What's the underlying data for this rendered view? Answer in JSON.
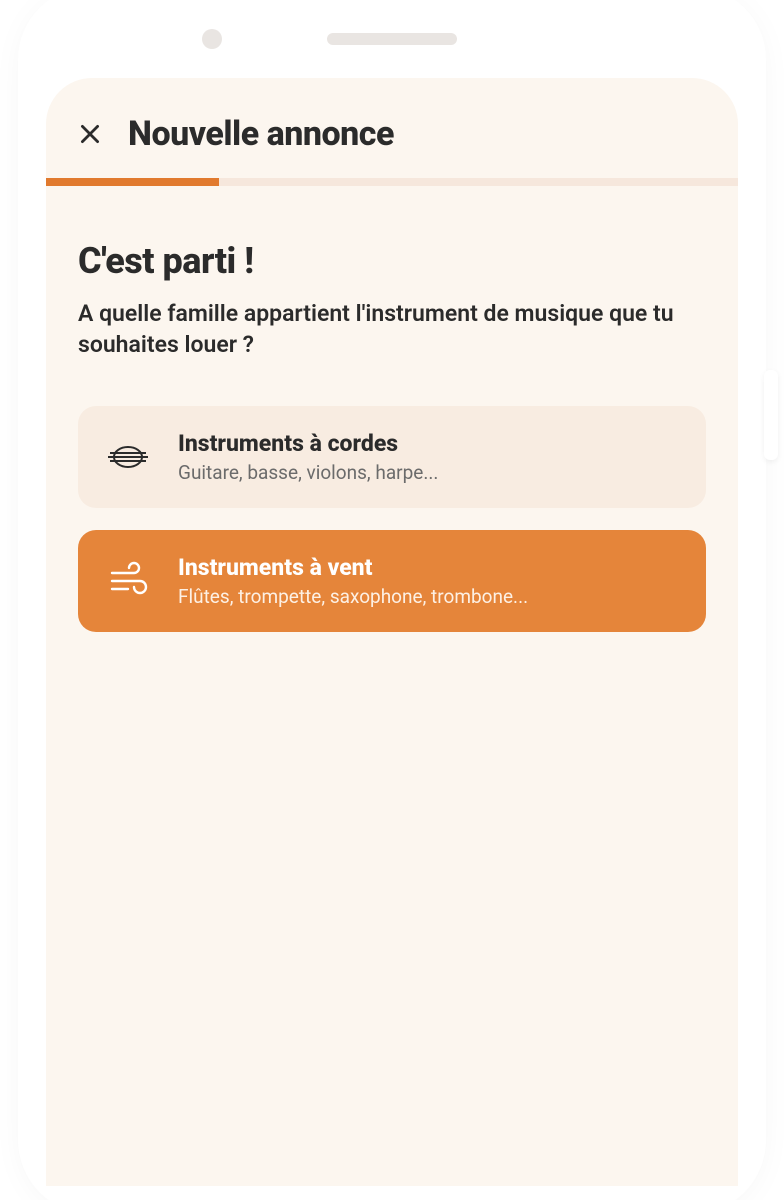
{
  "header": {
    "title": "Nouvelle annonce"
  },
  "progress": {
    "percent": 25
  },
  "content": {
    "heading": "C'est parti !",
    "subheading": "A quelle famille appartient l'instrument de musique que tu souhaites louer ?"
  },
  "options": [
    {
      "title": "Instruments à cordes",
      "subtitle": "Guitare, basse, violons, harpe...",
      "selected": false,
      "icon": "strings-icon"
    },
    {
      "title": "Instruments à vent",
      "subtitle": "Flûtes, trompette, saxophone, trombone...",
      "selected": true,
      "icon": "wind-icon"
    }
  ]
}
